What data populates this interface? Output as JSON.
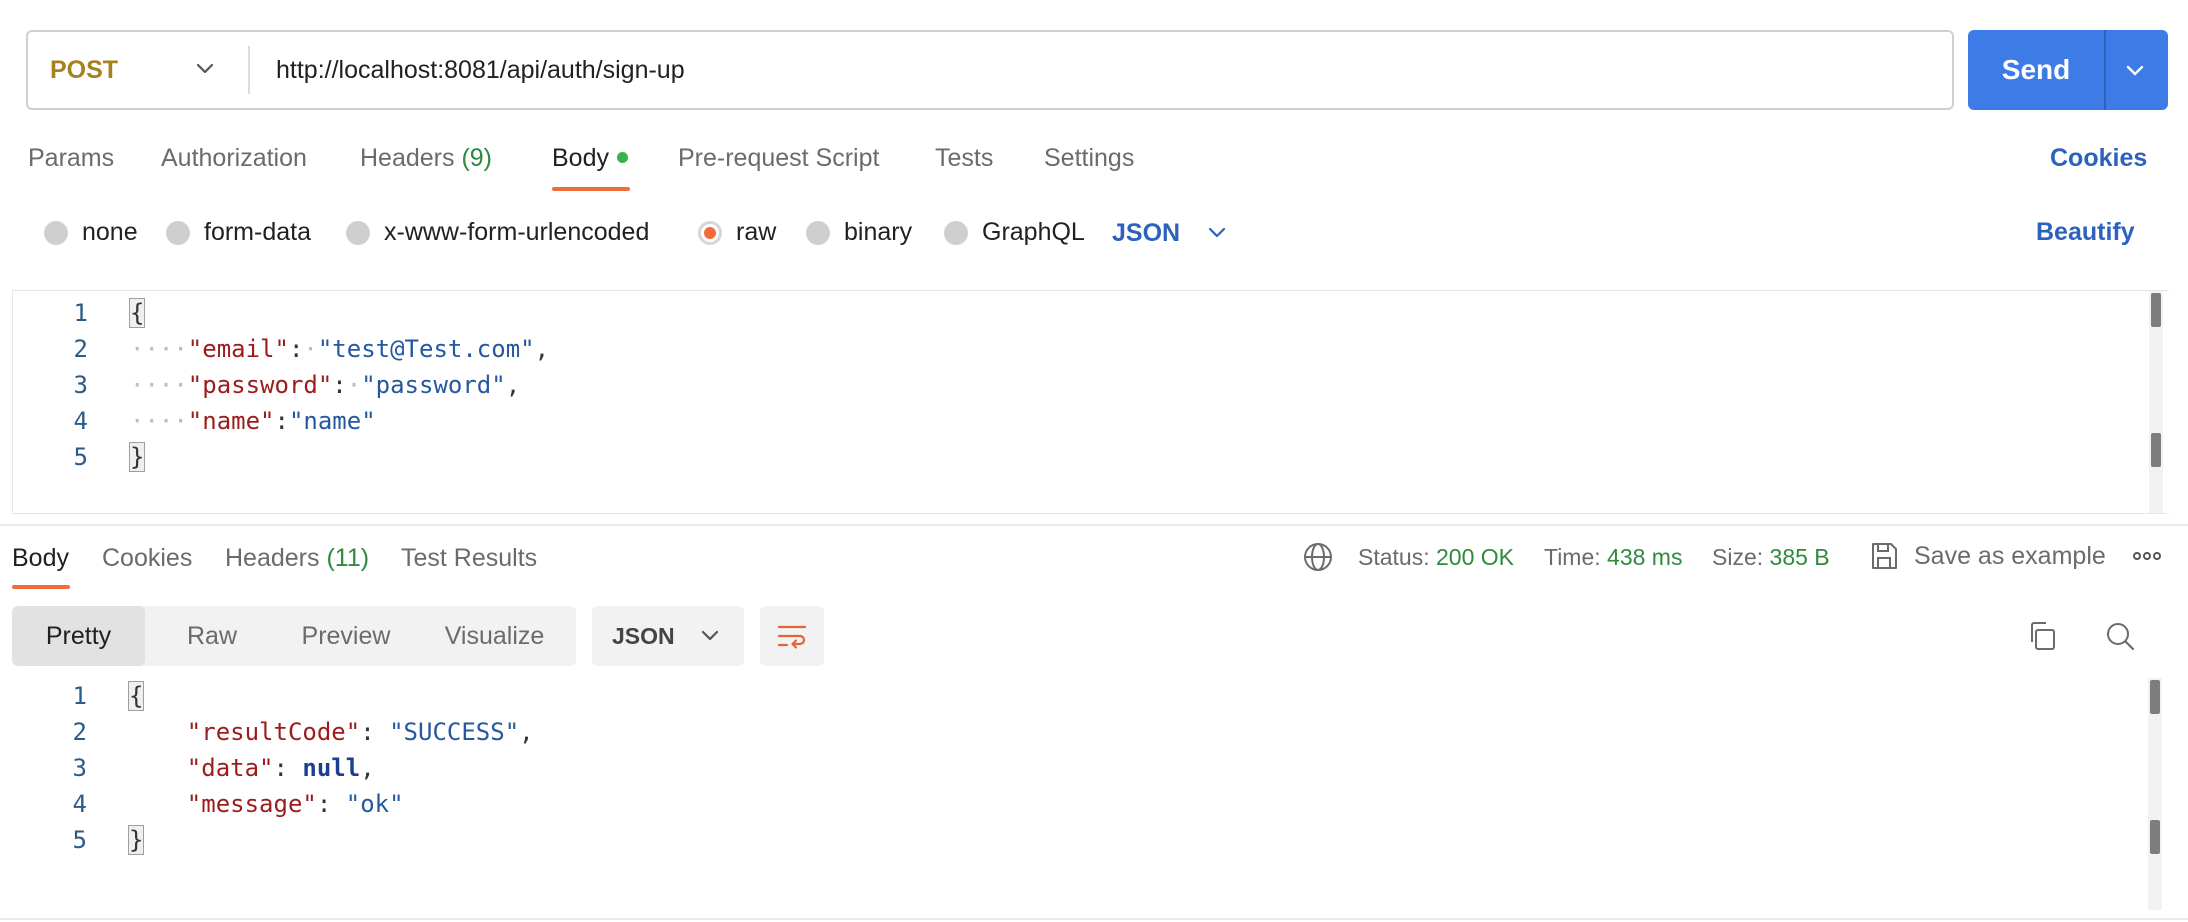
{
  "request": {
    "method": "POST",
    "url": "http://localhost:8081/api/auth/sign-up",
    "send_label": "Send"
  },
  "request_tabs": [
    {
      "label": "Params"
    },
    {
      "label": "Authorization"
    },
    {
      "label": "Headers",
      "count": "(9)"
    },
    {
      "label": "Body"
    },
    {
      "label": "Pre-request Script"
    },
    {
      "label": "Tests"
    },
    {
      "label": "Settings"
    }
  ],
  "cookies_label": "Cookies",
  "body_types": [
    {
      "label": "none"
    },
    {
      "label": "form-data"
    },
    {
      "label": "x-www-form-urlencoded"
    },
    {
      "label": "raw",
      "selected": true
    },
    {
      "label": "binary"
    },
    {
      "label": "GraphQL"
    }
  ],
  "body_format": "JSON",
  "beautify_label": "Beautify",
  "request_body": {
    "line_numbers": [
      "1",
      "2",
      "3",
      "4",
      "5"
    ],
    "open": "{",
    "close": "}",
    "fields": [
      {
        "key": "\"email\"",
        "value": "\"test@Test.com\"",
        "comma": ","
      },
      {
        "key": "\"password\"",
        "value": "\"password\"",
        "comma": ","
      },
      {
        "key": "\"name\"",
        "value": "\"name\"",
        "comma": ""
      }
    ]
  },
  "response_tabs": [
    {
      "label": "Body"
    },
    {
      "label": "Cookies"
    },
    {
      "label": "Headers",
      "count": "(11)"
    },
    {
      "label": "Test Results"
    }
  ],
  "response_meta": {
    "status_label": "Status:",
    "status_value": "200 OK",
    "time_label": "Time:",
    "time_value": "438 ms",
    "size_label": "Size:",
    "size_value": "385 B",
    "save_example": "Save as example"
  },
  "view_modes": [
    "Pretty",
    "Raw",
    "Preview",
    "Visualize"
  ],
  "response_format": "JSON",
  "response_body": {
    "line_numbers": [
      "1",
      "2",
      "3",
      "4",
      "5"
    ],
    "open": "{",
    "close": "}",
    "fields": [
      {
        "key": "\"resultCode\"",
        "value": "\"SUCCESS\"",
        "comma": ","
      },
      {
        "key": "\"data\"",
        "value": "null",
        "comma": ","
      },
      {
        "key": "\"message\"",
        "value": "\"ok\"",
        "comma": ""
      }
    ]
  },
  "colors": {
    "accent": "#f26b3a",
    "send": "#3d7ce6",
    "link": "#2c62bd",
    "method": "#a6811d",
    "success": "#2f8a3e"
  }
}
